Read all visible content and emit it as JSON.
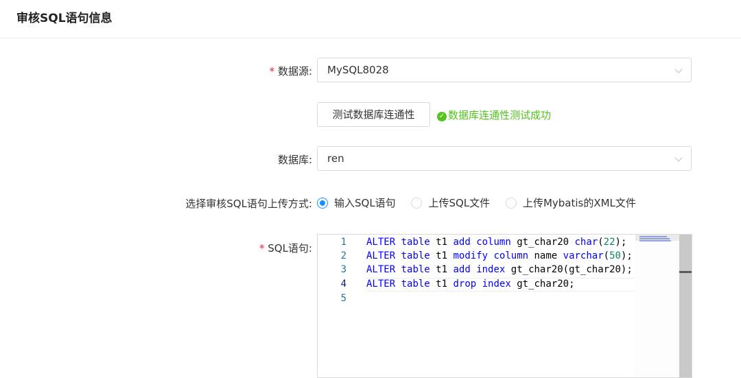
{
  "header": {
    "title": "审核SQL语句信息"
  },
  "form": {
    "datasource": {
      "label": "数据源:",
      "required_mark": "*",
      "value": "MySQL8028"
    },
    "test_button": {
      "label": "测试数据库连通性"
    },
    "test_status": {
      "icon": "check-circle-icon",
      "text": "数据库连通性测试成功",
      "color": "#52c41a"
    },
    "database": {
      "label": "数据库:",
      "value": "ren"
    },
    "upload_mode": {
      "label": "选择审核SQL语句上传方式:",
      "options": [
        "输入SQL语句",
        "上传SQL文件",
        "上传Mybatis的XML文件"
      ],
      "selected": "输入SQL语句"
    },
    "sql": {
      "label": "SQL语句:",
      "required_mark": "*"
    }
  },
  "editor": {
    "line_numbers": [
      "1",
      "2",
      "3",
      "4",
      "5"
    ],
    "active_line": 4,
    "lines": [
      "ALTER table t1 add column gt_char20 char(22);",
      "ALTER table t1 modify column name varchar(50);",
      "ALTER table t1 add index gt_char20(gt_char20);",
      "ALTER table t1 drop index gt_char20;",
      ""
    ],
    "keyword_color": "#0000ff",
    "number_color": "#098658"
  },
  "colors": {
    "accent": "#1890ff",
    "required": "#f5222d",
    "success": "#52c41a"
  }
}
